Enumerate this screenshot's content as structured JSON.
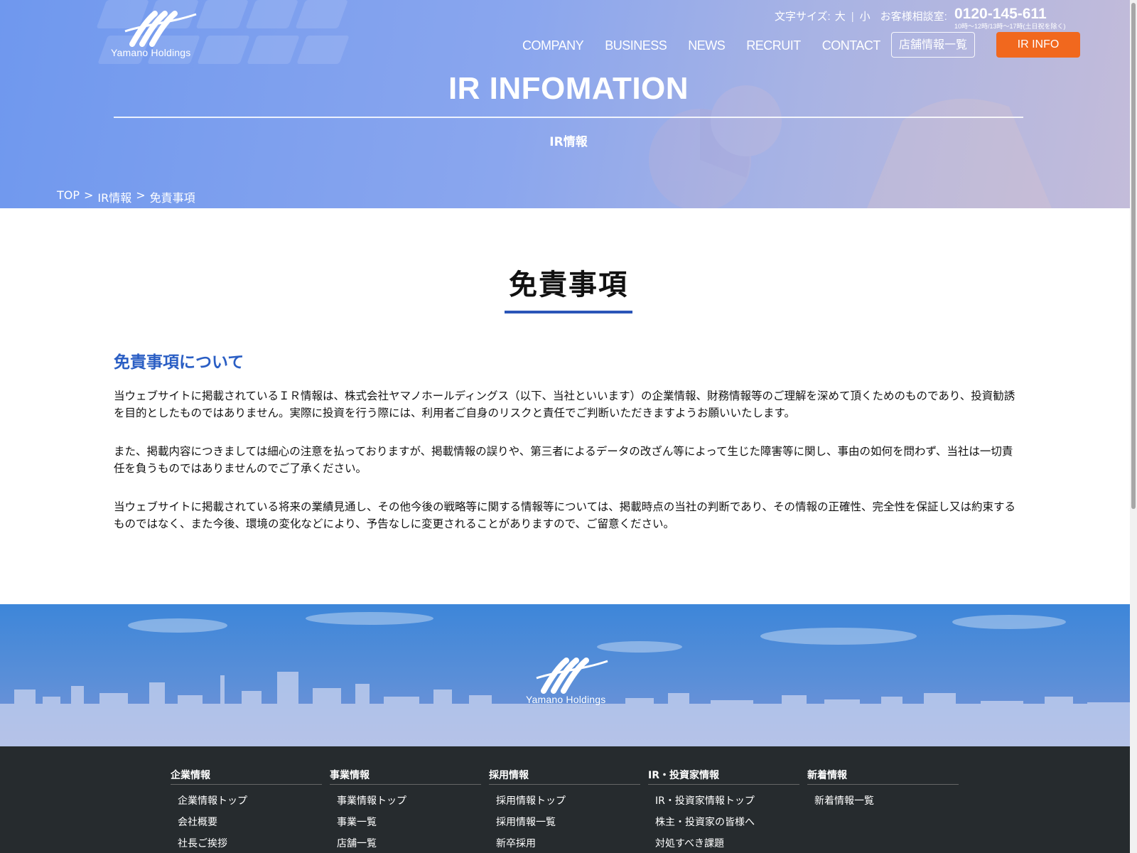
{
  "header": {
    "logo_text": "Yamano Holdings",
    "font_size_label": "文字サイズ:",
    "font_size_large": "大",
    "font_size_separator": "|",
    "font_size_small": "小",
    "consult_label": "お客様相談室:",
    "phone": "0120-145-611",
    "phone_hours": "10時〜12時/13時〜17時(土日祝を除く)",
    "nav": [
      "COMPANY",
      "BUSINESS",
      "NEWS",
      "RECRUIT",
      "CONTACT"
    ],
    "store_button": "店舗情報一覧",
    "ir_button": "IR INFO"
  },
  "hero": {
    "title": "IR INFOMATION",
    "subtitle": "IR情報",
    "breadcrumb": [
      "TOP",
      ">",
      "IR情報",
      ">",
      "免責事項"
    ]
  },
  "main": {
    "title": "免責事項",
    "section_heading": "免責事項について",
    "paragraphs": [
      "当ウェブサイトに掲載されているＩＲ情報は、株式会社ヤマノホールディングス（以下、当社といいます）の企業情報、財務情報等のご理解を深めて頂くためのものであり、投資勧誘を目的としたものではありません。実際に投資を行う際には、利用者ご自身のリスクと責任でご判断いただきますようお願いいたします。",
      "また、掲載内容につきましては細心の注意を払っておりますが、掲載情報の誤りや、第三者によるデータの改ざん等によって生じた障害等に関し、事由の如何を問わず、当社は一切責任を負うものではありませんのでご了承ください。",
      "当ウェブサイトに掲載されている将来の業績見通し、その他今後の戦略等に関する情報等については、掲載時点の当社の判断であり、その情報の正確性、完全性を保証し又は約束するものではなく、また今後、環境の変化などにより、予告なしに変更されることがありますので、ご留意ください。"
    ]
  },
  "footer": {
    "logo_text": "Yamano Holdings",
    "columns": [
      {
        "heading": "企業情報",
        "items": [
          "企業情報トップ",
          "会社概要",
          "社長ご挨拶"
        ]
      },
      {
        "heading": "事業情報",
        "items": [
          "事業情報トップ",
          "事業一覧",
          "店舗一覧"
        ]
      },
      {
        "heading": "採用情報",
        "items": [
          "採用情報トップ",
          "採用情報一覧",
          "新卒採用"
        ]
      },
      {
        "heading": "IR・投資家情報",
        "items": [
          "IR・投資家情報トップ",
          "株主・投資家の皆様へ",
          "対処すべき課題"
        ]
      },
      {
        "heading": "新着情報",
        "items": [
          "新着情報一覧"
        ]
      }
    ]
  },
  "colors": {
    "accent_blue": "#2a5ec4",
    "ir_button": "#f1681e",
    "footer_bg": "#262b2e"
  }
}
